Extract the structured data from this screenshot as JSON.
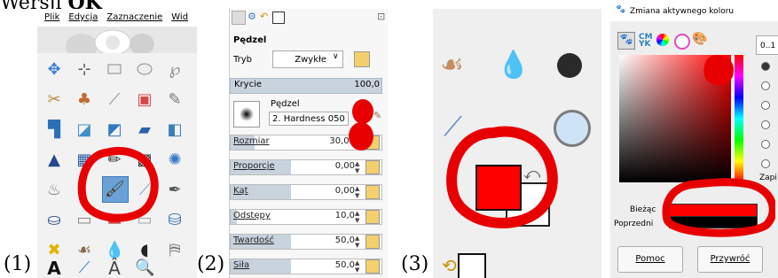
{
  "header": {
    "title_prefix": "Wersji ",
    "title_bold": "OK"
  },
  "captions": [
    "(1)",
    "(2)",
    "(3)"
  ],
  "panel1": {
    "menu": [
      "Plik",
      "Edycja",
      "Zaznaczenie",
      "Wid"
    ],
    "tools": [
      "move-icon",
      "align-icon",
      "rect-select-icon",
      "ellipse-select-icon",
      "free-select-icon",
      "scissors-icon",
      "fuzzy-select-icon",
      "wand-icon",
      "color-select-icon",
      "paths-icon",
      "crop-icon",
      "rotate-icon",
      "scale-icon",
      "shear-icon",
      "perspective-icon",
      "bucket-fill-icon",
      "blend-icon",
      "pencil-icon",
      "checker-icon",
      "heal-icon",
      "dodge-icon",
      "paintbrush-icon",
      "airbrush-icon",
      "ink-icon",
      "clone-icon",
      "stamp-icon",
      "smudge-icon",
      "blur-icon",
      "eraser-icon",
      "bucket-icon",
      "puzzle-icon",
      "smudge2-icon",
      "drop-icon",
      "brush-dot-icon",
      "fill-icon",
      "text-icon",
      "picker-icon",
      "measure-icon",
      "zoom-icon"
    ]
  },
  "panel2": {
    "tool_title": "Pędzel",
    "mode_label": "Tryb",
    "mode_value": "Zwykłe",
    "opacity_label": "Krycie",
    "opacity_value": "100,0",
    "brush_label": "Pędzel",
    "brush_value": "2. Hardness 050",
    "sliders": [
      {
        "label": "Rozmiar",
        "value": "30,00",
        "fill": 0.2
      },
      {
        "label": "Proporcje",
        "value": "0,00",
        "fill": 0.5
      },
      {
        "label": "Kąt",
        "value": "0,00",
        "fill": 0.5
      },
      {
        "label": "Odstępy",
        "value": "10,0",
        "fill": 0.05
      },
      {
        "label": "Twardość",
        "value": "50,0",
        "fill": 0.5
      },
      {
        "label": "Siła",
        "value": "50,0",
        "fill": 0.5
      }
    ]
  },
  "panel4": {
    "title": "Zmiana aktywnego koloru",
    "range_label": "0..1",
    "current_label": "Bieżąc",
    "previous_label": "Poprzedni",
    "save_label": "Zapi",
    "help_button": "Pomoc",
    "reset_button": "Przywróć"
  },
  "colors": {
    "accent_red": "#e80000",
    "selection_blue": "#6aa2d8",
    "fg_color": "#ff0000",
    "bg_color": "#ffffff"
  }
}
